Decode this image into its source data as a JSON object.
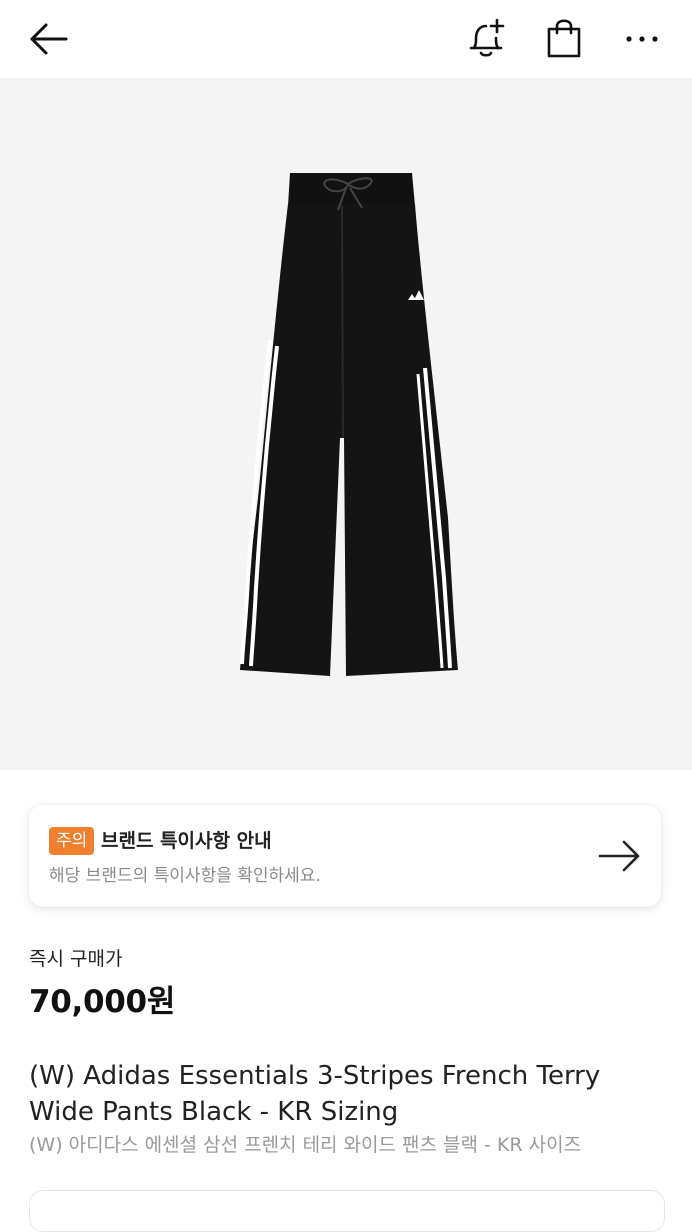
{
  "header": {
    "back_icon": "arrow-left-icon",
    "actions": [
      "bell-plus-icon",
      "shopping-bag-icon",
      "more-horizontal-icon"
    ]
  },
  "product": {
    "image": "black-wide-leg-track-pants-with-white-three-stripes",
    "brand_mark": "adidas",
    "instant_buy_label": "즉시 구매가",
    "price": "70,000원",
    "name_en": "(W) Adidas Essentials 3-Stripes French Terry Wide Pants Black - KR Sizing",
    "name_ko": "(W) 아디다스 에센셜 삼선 프렌치 테리 와이드 팬츠 블랙 - KR 사이즈"
  },
  "notice": {
    "badge": "주의",
    "title": "브랜드 특이사항 안내",
    "subtitle": "해당 브랜드의 특이사항을 확인하세요.",
    "badge_color": "#f0802f"
  }
}
